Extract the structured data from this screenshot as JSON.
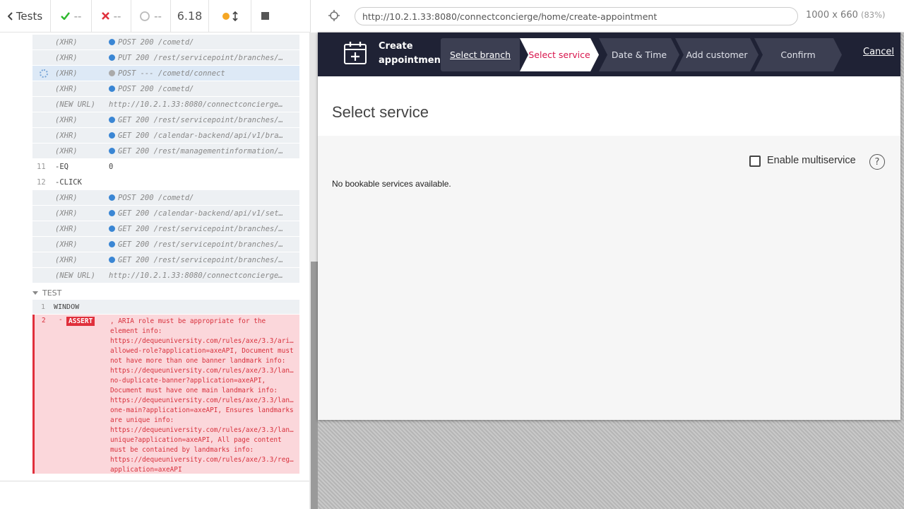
{
  "reporter": {
    "tests_label": "Tests",
    "passed": "--",
    "failed": "--",
    "pending": "--",
    "duration": "6.18",
    "commands": [
      {
        "num": "",
        "name": "(XHR)",
        "msg": "POST 200 /cometd/",
        "bullet": "blue"
      },
      {
        "num": "",
        "name": "(XHR)",
        "msg": "PUT 200 /rest/servicepoint/branches/…",
        "bullet": "blue"
      },
      {
        "num": "",
        "name": "(XHR)",
        "msg": "POST --- /cometd/connect",
        "bullet": "gray",
        "active": true
      },
      {
        "num": "",
        "name": "(XHR)",
        "msg": "POST 200 /cometd/",
        "bullet": "blue"
      },
      {
        "num": "",
        "name": "(NEW URL)",
        "msg": "http://10.2.1.33:8080/connectconcierge…",
        "bullet": ""
      },
      {
        "num": "",
        "name": "(XHR)",
        "msg": "GET 200 /rest/servicepoint/branches/…",
        "bullet": "blue"
      },
      {
        "num": "",
        "name": "(XHR)",
        "msg": "GET 200 /calendar-backend/api/v1/bra…",
        "bullet": "blue"
      },
      {
        "num": "",
        "name": "(XHR)",
        "msg": "GET 200 /rest/managementinformation/…",
        "bullet": "blue"
      },
      {
        "num": "11",
        "name": "-EQ",
        "msg": "0",
        "bullet": "",
        "plain": true
      },
      {
        "num": "12",
        "name": "-CLICK",
        "msg": "",
        "bullet": "",
        "plain": true
      },
      {
        "num": "",
        "name": "(XHR)",
        "msg": "POST 200 /cometd/",
        "bullet": "blue"
      },
      {
        "num": "",
        "name": "(XHR)",
        "msg": "GET 200 /calendar-backend/api/v1/set…",
        "bullet": "blue"
      },
      {
        "num": "",
        "name": "(XHR)",
        "msg": "GET 200 /rest/servicepoint/branches/…",
        "bullet": "blue"
      },
      {
        "num": "",
        "name": "(XHR)",
        "msg": "GET 200 /rest/servicepoint/branches/…",
        "bullet": "blue"
      },
      {
        "num": "",
        "name": "(XHR)",
        "msg": "GET 200 /rest/servicepoint/branches/…",
        "bullet": "blue"
      },
      {
        "num": "",
        "name": "(NEW URL)",
        "msg": "http://10.2.1.33:8080/connectconcierge…",
        "bullet": ""
      }
    ],
    "test_section_label": "TEST",
    "window_row": {
      "num": "1",
      "name": "WINDOW"
    },
    "assert_row": {
      "num": "2",
      "dash": "-",
      "badge": "ASSERT",
      "text": ", ARIA role must be appropriate for the\nelement info:\nhttps://dequeuniversity.com/rules/axe/3.3/ari…\nallowed-role?application=axeAPI, Document must\nnot have more than one banner landmark info:\nhttps://dequeuniversity.com/rules/axe/3.3/lan…\nno-duplicate-banner?application=axeAPI,\nDocument must have one main landmark info:\nhttps://dequeuniversity.com/rules/axe/3.3/lan…\none-main?application=axeAPI, Ensures landmarks\nare unique info:\nhttps://dequeuniversity.com/rules/axe/3.3/lan…\nunique?application=axeAPI, All page content\nmust be contained by landmarks info:\nhttps://dequeuniversity.com/rules/axe/3.3/reg…\napplication=axeAPI"
    }
  },
  "preview": {
    "url": "http://10.2.1.33:8080/connectconcierge/home/create-appointment",
    "viewport": "1000 x 660",
    "zoom": "(83%)"
  },
  "app": {
    "nav_title": "Create appointment",
    "steps": [
      {
        "label": "Select branch"
      },
      {
        "label": "Select service"
      },
      {
        "label": "Date & Time"
      },
      {
        "label": "Add customer"
      },
      {
        "label": "Confirm"
      }
    ],
    "cancel": "Cancel",
    "page_title": "Select service",
    "multiservice_label": "Enable multiservice",
    "help_glyph": "?",
    "empty_message": "No bookable services available.",
    "colors": {
      "nav_bg": "#1f2235",
      "active_step_text": "#d8164d"
    }
  }
}
